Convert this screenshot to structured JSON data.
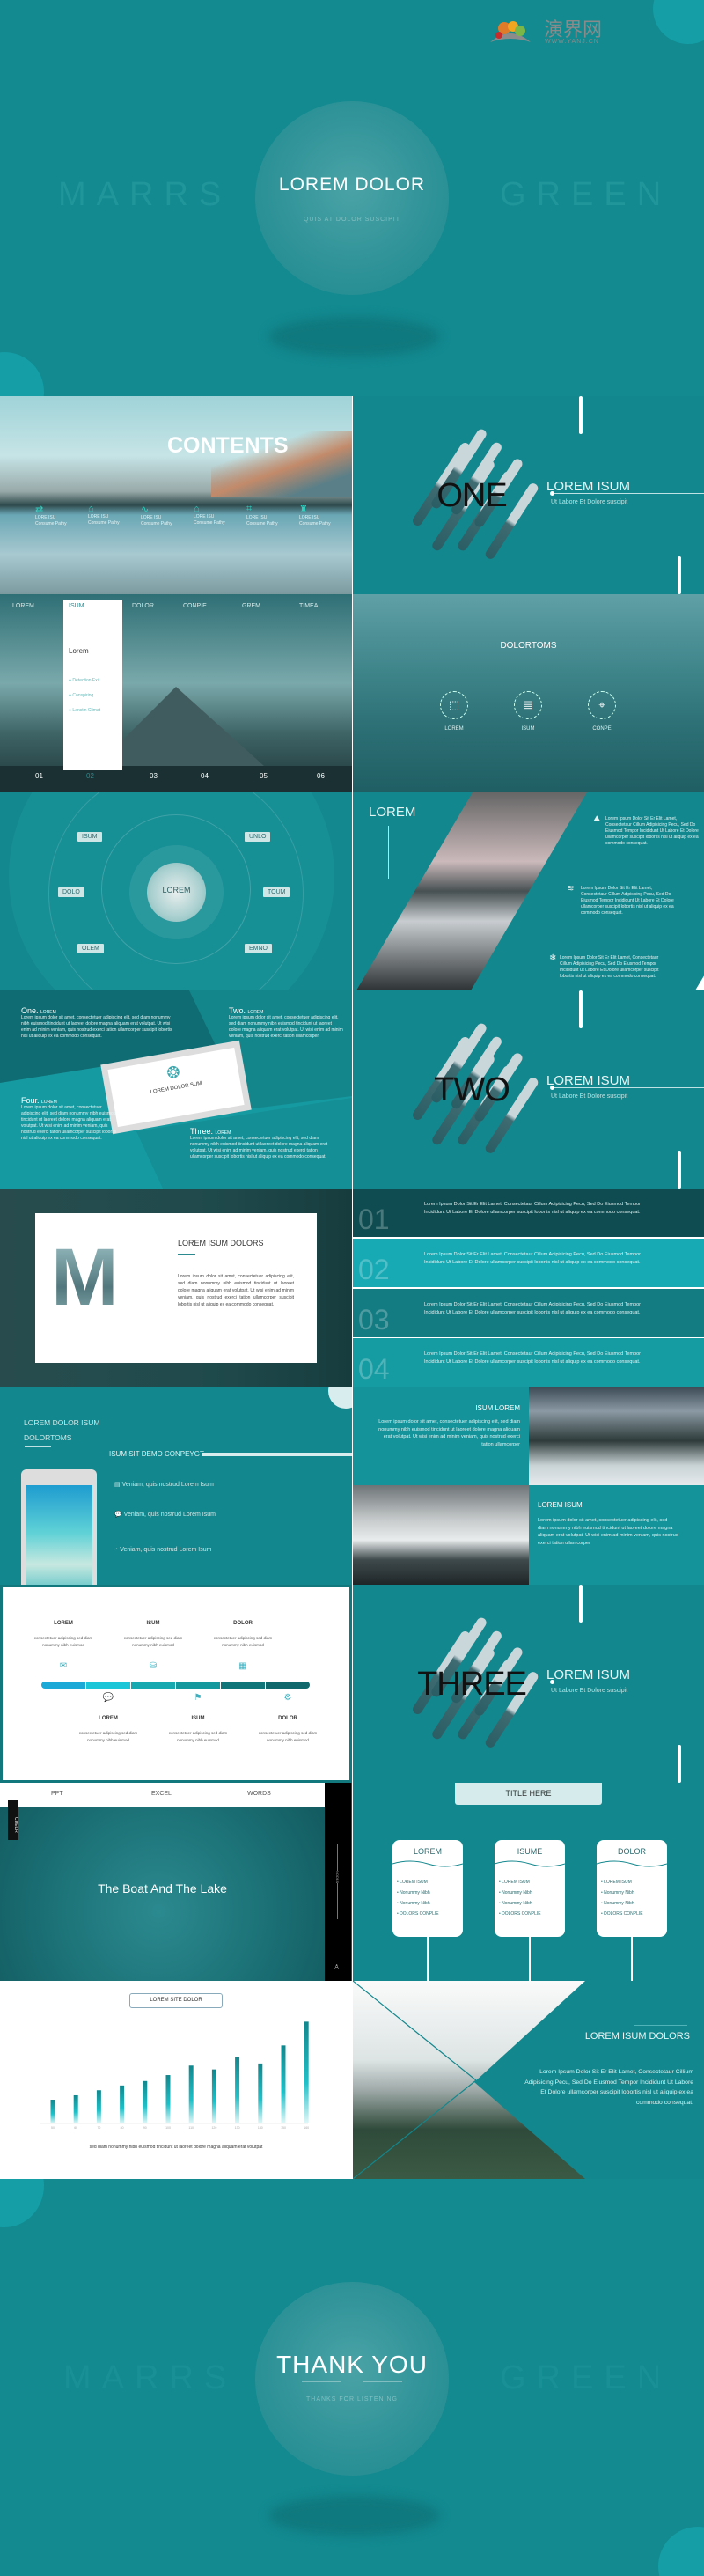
{
  "colors": {
    "teal": "#12878d",
    "teal_light": "#17a7b0",
    "teal_dark": "#0d5e63",
    "white": "#ffffff"
  },
  "hero": {
    "logo_text": "演界网",
    "logo_url_text": "WWW.YANJ.CN",
    "left_word": "MARRS",
    "right_word": "GREEN",
    "title": "LOREM  DOLOR",
    "subtitle": "QUIS AT DOLOR SUSCIPIT"
  },
  "contents": {
    "title": "CONTENTS",
    "items": [
      {
        "icon": "repeat-icon",
        "l1": "LORE ISU",
        "l2": "Consume Pathy"
      },
      {
        "icon": "house-scene-icon",
        "l1": "LORE ISU",
        "l2": "Consume Pathy"
      },
      {
        "icon": "pulse-icon",
        "l1": "LORE ISU",
        "l2": "Consume Pathy"
      },
      {
        "icon": "home-icon",
        "l1": "LORE ISU",
        "l2": "Consume Pathy"
      },
      {
        "icon": "scan-icon",
        "l1": "LORE ISU",
        "l2": "Consume Pathy"
      },
      {
        "icon": "building-icon",
        "l1": "LORE ISU",
        "l2": "Consume Pathy"
      }
    ]
  },
  "sections": [
    {
      "big": "ONE",
      "title": "LOREM  ISUM",
      "sub": "Ut Labore Et Dolore suscipit"
    },
    {
      "big": "TWO",
      "title": "LOREM  ISUM",
      "sub": "Ut Labore Et Dolore suscipit"
    },
    {
      "big": "THREE",
      "title": "LOREM  ISUM",
      "sub": "Ut Labore Et Dolore suscipit"
    }
  ],
  "tabs_slide": {
    "tabs": [
      "LOREM",
      "ISUM",
      "DOLOR",
      "CONPIE",
      "GREM",
      "TIMEA"
    ],
    "active": 1,
    "numbers": [
      "01",
      "02",
      "03",
      "04",
      "05",
      "06"
    ],
    "panel_title": "Lorem",
    "panel_items": [
      "Detection  Exit",
      "Conspiring",
      "Lanstin Climat"
    ]
  },
  "dolortoms": {
    "title": "DOLORTOMS",
    "items": [
      {
        "icon": "box-icon",
        "label": "LOREM"
      },
      {
        "icon": "document-icon",
        "label": "ISUM"
      },
      {
        "icon": "location-pin-icon",
        "label": "CONPE"
      }
    ]
  },
  "orbit": {
    "center": "LOREM",
    "nodes": [
      "ISUM",
      "UNLO",
      "DOLO",
      "TOUM",
      "OLEM",
      "EMNO"
    ]
  },
  "diag": {
    "title": "LOREM",
    "items": [
      {
        "icon": "mountain-icon",
        "text": "Lorem Ipsum Dolor Sit Er Elit Lamet, Consectetaur Cillum Adipisicing Pecu, Sed Do Eiusmod Tempor Incididunt Ut Labore Et Dolore ullamcorper suscipit lobortis nisl ut aliquip ex ea commodo consequat."
      },
      {
        "icon": "wind-icon",
        "text": "Lorem Ipsum Dolor Sit Er Elit Lamet, Consectetaur Cillum Adipisicing Pecu, Sed Do Eiusmod Tempor Incididunt Ut Labore Et Dolore ullamcorper suscipit lobortis nisl ut aliquip ex ea commodo consequat."
      },
      {
        "icon": "snowflake-icon",
        "text": "Lorem Ipsum Dolor Sit Er Elit Lamet, Consectetaur Cillum Adipisicing Pecu, Sed Do Eiusmod Tempor Incididunt Ut Labore Et Dolore ullamcorper suscipit lobortis nisl ut aliquip ex ea commodo consequat."
      }
    ]
  },
  "quad": {
    "center": "LOREM DOLOR SUM",
    "blocks": [
      {
        "head": "One.",
        "tag": "LOREM",
        "text": "Lorem ipsum dolor sit amet, consectetuer adipiscing elit, sed diam nonummy nibh euismod tincidunt ut laoreet dolore magna aliquam erat volutpat. Ut wisi enim ad minim veniam, quis nostrud exerci tation ullamcorper suscipit lobortis nisl ut aliquip ex ea commodo consequat."
      },
      {
        "head": "Two.",
        "tag": "LOREM",
        "text": "Lorem ipsum dolor sit amet, consectetuer adipiscing elit, sed diam nonummy nibh euismod tincidunt ut laoreet dolore magna aliquam erat volutpat. Ut wisi enim ad minim veniam, quis nostrud exerci tation ullamcorper"
      },
      {
        "head": "Three.",
        "tag": "LOREM",
        "text": "Lorem ipsum dolor sit amet, consectetuer adipiscing elit, sed diam nonummy nibh euismod tincidunt ut laoreet dolore magna aliquam erat volutpat. Ut wisi enim ad minim veniam, quis nostrud exerci tation ullamcorper suscipit lobortis nisl ut aliquip ex ea commodo consequat."
      },
      {
        "head": "Four.",
        "tag": "LOREM",
        "text": "Lorem ipsum dolor sit amet, consectetuer adipiscing elit, sed diam nonummy nibh euismod tincidunt ut laoreet dolore magna aliquam erat volutpat. Ut wisi enim ad minim veniam, quis nostrud exerci tation ullamcorper suscipit lobortis nisl ut aliquip ex ea commodo consequat."
      }
    ]
  },
  "mcard": {
    "letter": "M",
    "title": "LOREM ISUM DOLORS",
    "text": "Lorem ipsum dolor sit amet, consectetuer adipiscing elit, sed diam nonummy nibh euismod tincidunt ut laoreet dolore magna aliquam erat volutpat. Ut wisi enim ad minim veniam, quis nostrud exerci tation ullamcorper suscipit lobortis nisl ut aliquip ex ea commodo consequat."
  },
  "numbered": [
    {
      "n": "01",
      "text": "Lorem Ipsum Dolor Sit Er Elit Lamet, Consectetaur Cillum  Adipisicing Pecu, Sed Do Eiusmod Tempor Incididunt Ut Labore Et Dolore ullamcorper suscipit lobortis nisl ut aliquip ex ea commodo consequat."
    },
    {
      "n": "02",
      "text": "Lorem Ipsum Dolor Sit Er Elit Lamet, Consectetaur Cillum  Adipisicing Pecu, Sed Do Eiusmod Tempor Incididunt Ut Labore Et Dolore ullamcorper suscipit lobortis nisl ut aliquip ex ea commodo consequat."
    },
    {
      "n": "03",
      "text": "Lorem Ipsum Dolor Sit Er Elit Lamet, Consectetaur Cillum  Adipisicing Pecu, Sed Do Eiusmod Tempor Incididunt Ut Labore Et Dolore ullamcorper suscipit lobortis nisl ut aliquip ex ea commodo consequat."
    },
    {
      "n": "04",
      "text": "Lorem Ipsum Dolor Sit Er Elit Lamet, Consectetaur Cillum  Adipisicing Pecu, Sed Do Eiusmod Tempor Incididunt Ut Labore Et Dolore ullamcorper suscipit lobortis nisl ut aliquip ex ea commodo consequat."
    }
  ],
  "tablet": {
    "title1": "LOREM  DOLOR  ISUM",
    "title2": "DOLORTOMS",
    "heading": "ISUM  SIT DEMO  CONPEYGT",
    "items": [
      {
        "icon": "clipboard-icon",
        "text": "Veniam, quis nostrud Lorem Isum"
      },
      {
        "icon": "chat-icon",
        "text": "Veniam, quis nostrud Lorem Isum"
      },
      {
        "icon": "pie-chart-icon",
        "text": "Veniam, quis nostrud Lorem Isum"
      }
    ]
  },
  "photos": {
    "t1": "ISUM LOREM",
    "p1": "Lorem ipsum dolor sit amet, consectetuer adipiscing elit, sed diam nonummy nibh euismod tincidunt ut laoreet dolore magna aliquam erat volutpat. Ut wisi enim ad minim veniam, quis nostrud exerci tation ullamcorper",
    "t2": "LOREM ISUM",
    "p2": "Lorem ipsum dolor sit amet, consectetuer adipiscing elit, sed diam nonummy nibh euismod tincidunt ut laoreet dolore magna aliquam erat volutpat. Ut wisi enim ad minim veniam, quis nostrud exerci tation ullamcorper"
  },
  "timeline": {
    "items": [
      {
        "title": "LOREM",
        "icon": "mail-icon",
        "text": "consectetuer adipiscing sed diam nonummy nibh euismod"
      },
      {
        "title": "LOREM",
        "icon": "chat-icon",
        "text": "consectetuer adipiscing sed diam nonummy nibh euismod"
      },
      {
        "title": "ISUM",
        "icon": "database-icon",
        "text": "consectetuer adipiscing sed diam nonummy nibh euismod"
      },
      {
        "title": "ISUM",
        "icon": "flag-icon",
        "text": "consectetuer adipiscing sed diam nonummy nibh euismod"
      },
      {
        "title": "DOLOR",
        "icon": "calendar-icon",
        "text": "consectetuer adipiscing sed diam nonummy nibh euismod"
      },
      {
        "title": "DOLOR",
        "icon": "gear-icon",
        "text": "consectetuer adipiscing sed diam nonummy nibh euismod"
      }
    ],
    "segment_colors": [
      "#1ba9d8",
      "#1ac6d8",
      "#16a9b0",
      "#14979d",
      "#0f7579",
      "#0e686c"
    ]
  },
  "boat": {
    "nav": [
      "PPT",
      "EXCEL",
      "WORDS"
    ],
    "side_tab": "CUEUR",
    "title": "The Boat And The Lake",
    "side_vertical": "NODES"
  },
  "cards": {
    "title": "TITLE HERE",
    "cards": [
      {
        "title": "LOREM",
        "items": [
          "LOREM ISUM",
          "Nonummy Nibh",
          "Nonummy Nibh",
          "DOLORS CONPLIE"
        ]
      },
      {
        "title": "ISUME",
        "items": [
          "LOREM ISUM",
          "Nonummy Nibh",
          "Nonummy Nibh",
          "DOLORS CONPLIE"
        ]
      },
      {
        "title": "DOLOR",
        "items": [
          "LOREM ISUM",
          "Nonummy Nibh",
          "Nonummy Nibh",
          "DOLORS CONPLIE"
        ]
      }
    ]
  },
  "chart_data": {
    "type": "bar",
    "title": "LOREM  SITE DOLOR",
    "categories": [
      "50",
      "60",
      "70",
      "80",
      "90",
      "100",
      "110",
      "120",
      "130",
      "140",
      "150",
      "160"
    ],
    "values": [
      80,
      95,
      112,
      128,
      143,
      163,
      195,
      182,
      225,
      202,
      263,
      343
    ],
    "caption": "sed diam nonummy nibh euismod tincidunt ut laoreet dolore magna aliquam erat volutpat",
    "grid": false,
    "legend": "none"
  },
  "final_text": {
    "title": "LOREM ISUM DOLORS",
    "text": "Lorem Ipsum Dolor Sit Er Elit Lamet, Consectetaur Cillium Adipisicing Pecu, Sed Do Eiusmod Tempor Incididunt Ut Labore Et Dolore ullamcorper suscipit lobortis nisl ut aliquip ex ea commodo consequat."
  },
  "thanks": {
    "left_word": "MARRS",
    "right_word": "GREEN",
    "title": "THANK  YOU",
    "subtitle": "THANKS FOR LISTENING"
  }
}
